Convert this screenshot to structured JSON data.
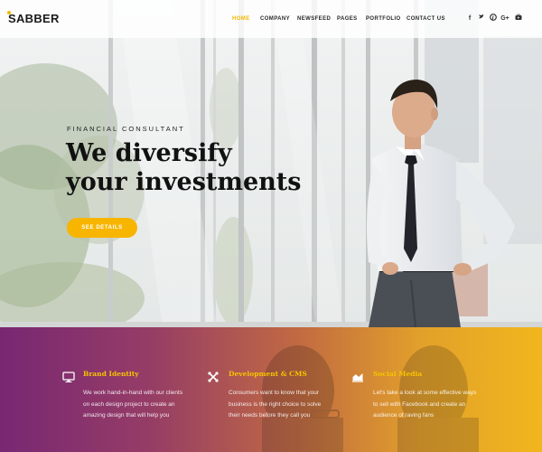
{
  "brand": {
    "logo": "SABBER",
    "accent": "#f5b800"
  },
  "nav": {
    "items": [
      {
        "label": "HOME",
        "active": true
      },
      {
        "label": "COMPANY",
        "active": false
      },
      {
        "label": "NEWSFEED",
        "active": false
      },
      {
        "label": "PAGES",
        "active": false
      },
      {
        "label": "PORTFOLIO",
        "active": false
      },
      {
        "label": "CONTACT US",
        "active": false
      }
    ],
    "social": [
      {
        "icon": "facebook-icon",
        "glyph": "f"
      },
      {
        "icon": "twitter-icon",
        "glyph": "∧"
      },
      {
        "icon": "pinterest-icon",
        "glyph": "℗"
      },
      {
        "icon": "google-plus-icon",
        "glyph": "G+"
      },
      {
        "icon": "youtube-icon",
        "glyph": "▶"
      }
    ]
  },
  "hero": {
    "eyebrow": "FINANCIAL CONSULTANT",
    "headline_line1": "We diversify",
    "headline_line2": "your investments",
    "cta": "SEE DETAILS"
  },
  "features": [
    {
      "icon": "monitor-icon",
      "title": "Brand Identity",
      "lines": [
        "We work hand-in-hand with our clients",
        "on each design project to create an",
        "amazing design that will help you"
      ]
    },
    {
      "icon": "joomla-icon",
      "title": "Development & CMS",
      "lines": [
        "Consumers want to know that your",
        "business is the right choice to solve",
        "their needs before they call you"
      ]
    },
    {
      "icon": "chart-icon",
      "title": "Social Media",
      "lines": [
        "Let's take a look at some effective ways",
        "to sell with Facebook and create an",
        "audience of raving fans"
      ]
    }
  ],
  "colors": {
    "gradient_start": "#782773",
    "gradient_end": "#f1b61d",
    "cta": "#f7b500",
    "feature_title": "#f6c400"
  }
}
